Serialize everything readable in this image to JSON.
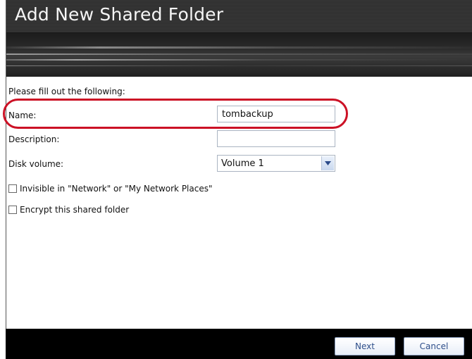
{
  "window": {
    "title": "Add New Shared Folder"
  },
  "form": {
    "intro": "Please fill out the following:",
    "name_label": "Name:",
    "name_value": "tombackup",
    "description_label": "Description:",
    "description_value": "",
    "volume_label": "Disk volume:",
    "volume_value": "Volume 1",
    "invisible_label": "Invisible in \"Network\" or \"My Network Places\"",
    "invisible_checked": false,
    "encrypt_label": "Encrypt this shared folder",
    "encrypt_checked": false
  },
  "footer": {
    "next_label": "Next",
    "cancel_label": "Cancel"
  },
  "colors": {
    "highlight": "#cc1125",
    "button_text": "#2f4f8a"
  }
}
